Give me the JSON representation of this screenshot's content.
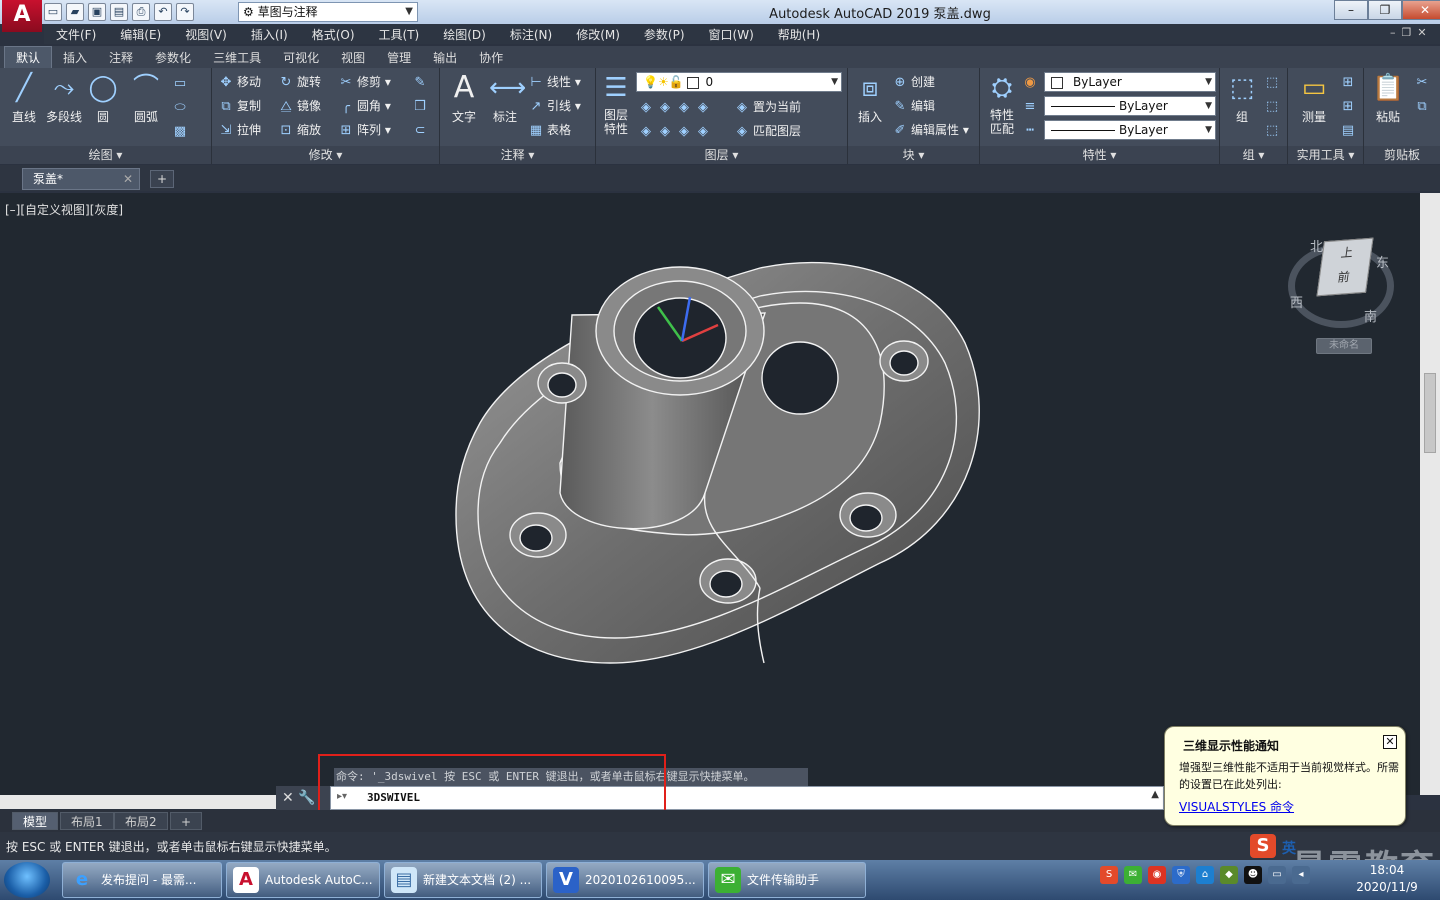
{
  "app": {
    "logo": "A",
    "title": "Autodesk AutoCAD 2019    泵盖.dwg",
    "workspace": "草图与注释"
  },
  "menu": [
    "文件(F)",
    "编辑(E)",
    "视图(V)",
    "插入(I)",
    "格式(O)",
    "工具(T)",
    "绘图(D)",
    "标注(N)",
    "修改(M)",
    "参数(P)",
    "窗口(W)",
    "帮助(H)"
  ],
  "ribbon_tabs": [
    "默认",
    "插入",
    "注释",
    "参数化",
    "三维工具",
    "可视化",
    "视图",
    "管理",
    "输出",
    "协作"
  ],
  "ribbon": {
    "draw": {
      "title": "绘图",
      "line": "直线",
      "polyline": "多段线",
      "circle": "圆",
      "arc": "圆弧"
    },
    "modify": {
      "title": "修改",
      "move": "移动",
      "rotate": "旋转",
      "trim": "修剪",
      "copy": "复制",
      "mirror": "镜像",
      "fillet": "圆角",
      "stretch": "拉伸",
      "scale": "缩放",
      "array": "阵列"
    },
    "annotation": {
      "title": "注释",
      "text": "文字",
      "dimension": "标注",
      "linear": "线性",
      "leader": "引线",
      "table": "表格"
    },
    "layers": {
      "title": "图层",
      "properties": "图层\n特性",
      "current_layer": "0",
      "make_current": "置为当前",
      "match_layer": "匹配图层"
    },
    "block": {
      "title": "块",
      "insert": "插入",
      "create": "创建",
      "edit": "编辑",
      "edit_attr": "编辑属性"
    },
    "properties": {
      "title": "特性",
      "match": "特性\n匹配",
      "color": "ByLayer",
      "linetype": "ByLayer",
      "lineweight": "ByLayer"
    },
    "groups": {
      "title": "组",
      "group": "组"
    },
    "utilities": {
      "title": "实用工具",
      "measure": "测量"
    },
    "clipboard": {
      "title": "剪贴板",
      "paste": "粘贴"
    }
  },
  "file_tab": "泵盖*",
  "viewport_label": "[–][自定义视图][灰度]",
  "viewcube": {
    "top": "上",
    "front": "前",
    "north": "北",
    "east": "东",
    "south": "南",
    "west": "西",
    "wcs": "未命名"
  },
  "command": {
    "history": "命令: '_3dswivel 按 ESC 或 ENTER 键退出，或者单击鼠标右键显示快捷菜单。",
    "input": "3DSWIVEL"
  },
  "layout_tabs": [
    "模型",
    "布局1",
    "布局2"
  ],
  "status_text": "按 ESC 或 ENTER 键退出，或者单击鼠标右键显示快捷菜单。",
  "notification": {
    "title": "三维显示性能通知",
    "body": "增强型三维性能不适用于当前视觉样式。所需的设置已在此处列出:",
    "link": "VISUALSTYLES 命令"
  },
  "watermark": {
    "text": "最需教育",
    "ime": "英"
  },
  "taskbar": {
    "items": [
      "发布提问 - 最需...",
      "Autodesk AutoC...",
      "新建文本文档 (2) ...",
      "2020102610095...",
      "文件传输助手"
    ],
    "time": "18:04",
    "date": "2020/11/9"
  },
  "colors": {
    "highlight": "#e0201a",
    "viewport": "#212830",
    "ribbon": "#434c5b"
  }
}
